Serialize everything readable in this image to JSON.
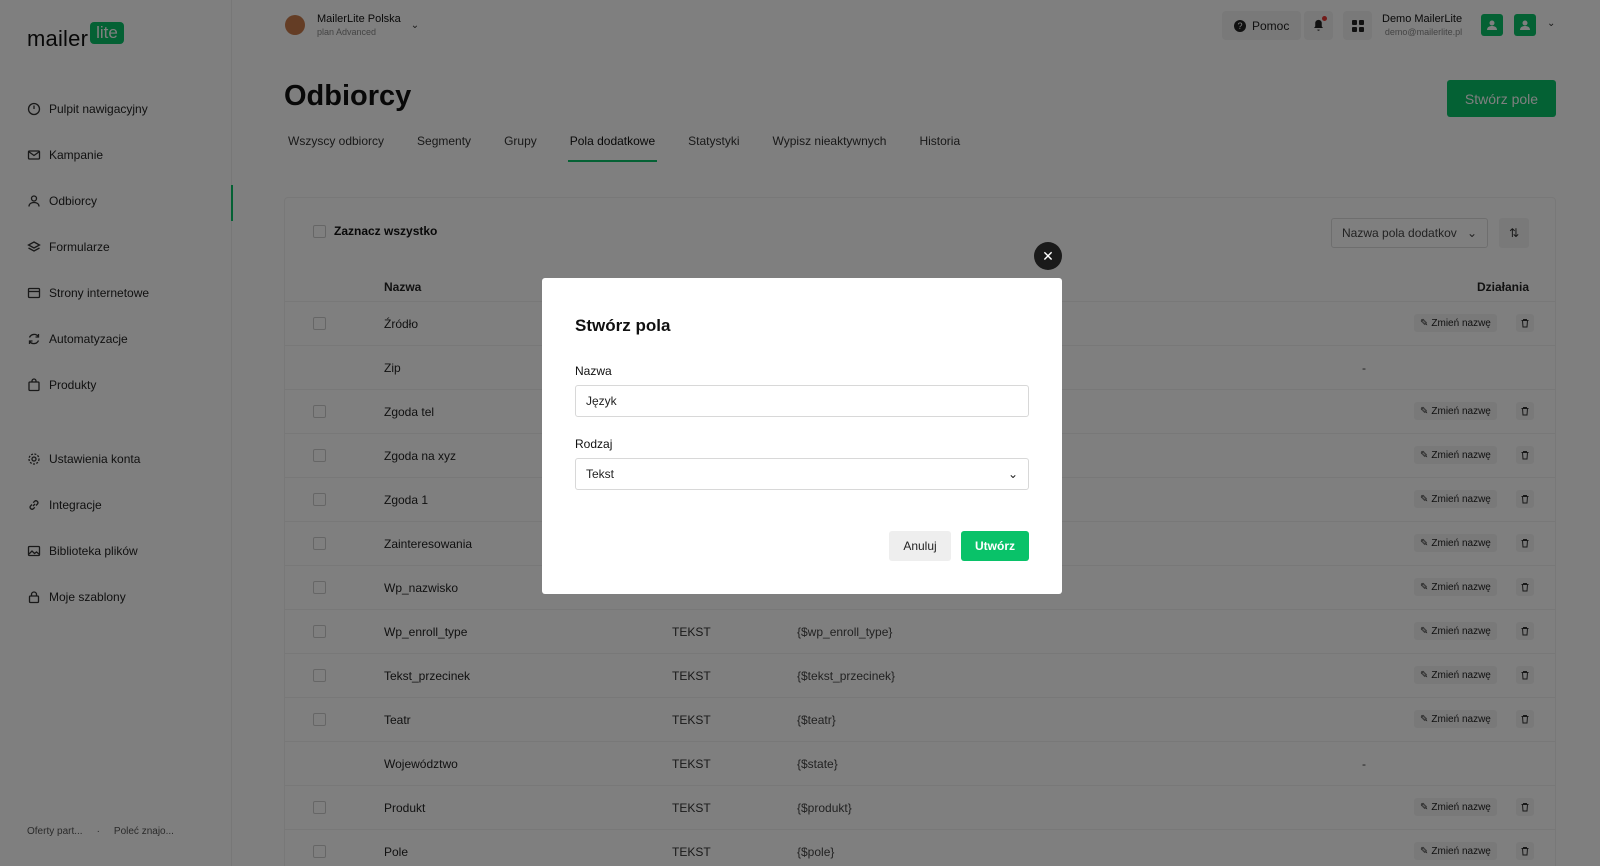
{
  "brand": {
    "word": "mailer",
    "badge": "lite",
    "accent": "#09c269"
  },
  "sidebar": {
    "items": [
      {
        "label": "Pulpit nawigacyjny",
        "icon": "dashboard-icon"
      },
      {
        "label": "Kampanie",
        "icon": "mail-icon"
      },
      {
        "label": "Odbiorcy",
        "icon": "user-icon",
        "active": true
      },
      {
        "label": "Formularze",
        "icon": "layers-icon"
      },
      {
        "label": "Strony internetowe",
        "icon": "browser-icon"
      },
      {
        "label": "Automatyzacje",
        "icon": "refresh-icon"
      },
      {
        "label": "Produkty",
        "icon": "bag-icon"
      }
    ],
    "items2": [
      {
        "label": "Ustawienia konta",
        "icon": "gear-icon"
      },
      {
        "label": "Integracje",
        "icon": "link-icon"
      },
      {
        "label": "Biblioteka plików",
        "icon": "image-icon"
      },
      {
        "label": "Moje szablony",
        "icon": "lock-icon"
      }
    ],
    "footer": {
      "left": "Oferty part...",
      "sep": "·",
      "right": "Poleć znajo..."
    }
  },
  "header": {
    "account_name": "MailerLite Polska",
    "account_plan": "plan Advanced",
    "help_label": "Pomoc",
    "user_name": "Demo MailerLite",
    "user_email": "demo@mailerlite.pl"
  },
  "page": {
    "title": "Odbiorcy",
    "create_label": "Stwórz pole",
    "tabs": [
      "Wszyscy odbiorcy",
      "Segmenty",
      "Grupy",
      "Pola dodatkowe",
      "Statystyki",
      "Wypisz nieaktywnych",
      "Historia"
    ],
    "active_tab": 3
  },
  "table": {
    "select_all": "Zaznacz wszystko",
    "sort_value": "Nazwa pola dodatkov",
    "col_name": "Nazwa",
    "col_actions": "Działania",
    "rename_label": "Zmień nazwę",
    "rows": [
      {
        "name": "Źródło",
        "type": "",
        "tag": "",
        "actions": true
      },
      {
        "name": "Zip",
        "type": "",
        "tag": "",
        "actions": false,
        "dash": "-"
      },
      {
        "name": "Zgoda tel",
        "type": "",
        "tag": "",
        "actions": true
      },
      {
        "name": "Zgoda na xyz",
        "type": "",
        "tag": "",
        "actions": true
      },
      {
        "name": "Zgoda 1",
        "type": "",
        "tag": "",
        "actions": true
      },
      {
        "name": "Zainteresowania",
        "type": "",
        "tag": "",
        "actions": true
      },
      {
        "name": "Wp_nazwisko",
        "type": "",
        "tag": "",
        "actions": true
      },
      {
        "name": "Wp_enroll_type",
        "type": "TEKST",
        "tag": "{$wp_enroll_type}",
        "actions": true
      },
      {
        "name": "Tekst_przecinek",
        "type": "TEKST",
        "tag": "{$tekst_przecinek}",
        "actions": true
      },
      {
        "name": "Teatr",
        "type": "TEKST",
        "tag": "{$teatr}",
        "actions": true
      },
      {
        "name": "Województwo",
        "type": "TEKST",
        "tag": "{$state}",
        "actions": false,
        "dash": "-"
      },
      {
        "name": "Produkt",
        "type": "TEKST",
        "tag": "{$produkt}",
        "actions": true
      },
      {
        "name": "Pole",
        "type": "TEKST",
        "tag": "{$pole}",
        "actions": true
      }
    ]
  },
  "modal": {
    "title": "Stwórz pola",
    "name_label": "Nazwa",
    "name_value": "Język",
    "type_label": "Rodzaj",
    "type_value": "Tekst",
    "cancel_label": "Anuluj",
    "submit_label": "Utwórz"
  }
}
